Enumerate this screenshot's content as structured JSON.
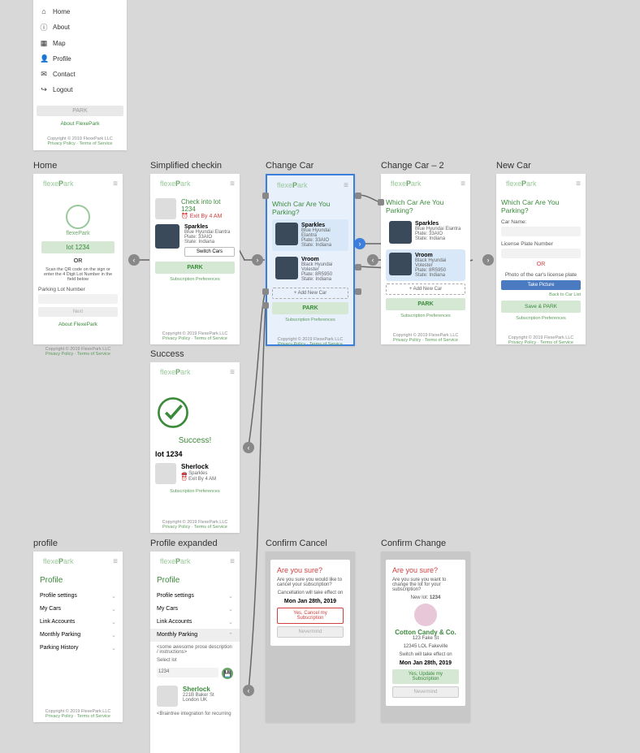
{
  "titles": {
    "home": "Home",
    "simplified": "Simplified checkin",
    "changeCar": "Change Car",
    "changeCar2": "Change Car – 2",
    "newCar": "New Car",
    "success": "Success",
    "profile": "profile",
    "profileExp": "Profile expanded",
    "confirmCancel": "Confirm Cancel",
    "confirmChange": "Confirm Change"
  },
  "sidebar": {
    "items": [
      {
        "icon": "⌂",
        "label": "Home"
      },
      {
        "icon": "ⓘ",
        "label": "About"
      },
      {
        "icon": "▦",
        "label": "Map"
      },
      {
        "icon": "👤",
        "label": "Profile"
      },
      {
        "icon": "✉",
        "label": "Contact"
      },
      {
        "icon": "↪",
        "label": "Logout"
      }
    ],
    "park_btn": "PARK",
    "about_link": "About FlexePark"
  },
  "brand": {
    "name": "flexePark"
  },
  "home": {
    "lot": "lot 1234",
    "or": "OR",
    "helper": "Scan the QR code on the sign or enter the 4 Digit Lot Number in the field below",
    "lot_label": "Parking Lot Number",
    "next": "Next",
    "about": "About FlexePark"
  },
  "footer": {
    "copyright": "Copyright © 2019 FlexePark LLC",
    "privacy": "Privacy Policy",
    "terms": "Terms of Service"
  },
  "checkin": {
    "title": "Check into lot 1234",
    "exit": "Exit By 4 AM",
    "car_name": "Sparkles",
    "car_desc": "Blue Hyundai Elantra",
    "plate": "Plate: 33AIO",
    "state": "State: Indiana",
    "switch": "Switch Cars",
    "park": "PARK",
    "prefs": "Subscription Preferences"
  },
  "change": {
    "title": "Which Car Are You Parking?",
    "car1_name": "Sparkles",
    "car1_desc": "Blue Hyundai Elantra",
    "car1_plate": "Plate: 33AIO",
    "car1_state": "State: Indiana",
    "car2_name": "Vroom",
    "car2_desc": "Black Hyundai Volester",
    "car2_plate": "Plate: 8R5950",
    "car2_state": "State: Indiana",
    "add": "+ Add New Car",
    "park": "PARK",
    "prefs": "Subscription Preferences"
  },
  "newcar": {
    "title": "Which Car Are You Parking?",
    "name_label": "Car Name:",
    "plate_label": "License Plate Number",
    "or": "OR",
    "photo_label": "Photo of the car's license plate",
    "take": "Take Picture",
    "back": "Back to Car List",
    "save": "Save & PARK",
    "prefs": "Subscription Preferences"
  },
  "success": {
    "title": "Success!",
    "lot": "lot 1234",
    "name": "Sherlock",
    "sub": "Sparkles",
    "exit": "Exit By 4 AM",
    "prefs": "Subscription Preferences"
  },
  "profile": {
    "title": "Profile",
    "items": [
      "Profile settings",
      "My Cars",
      "Link Accounts",
      "Monthly Parking",
      "Parking History"
    ]
  },
  "profileExp": {
    "desc": "<some awesome prose description / instructions>",
    "select": "Select lot",
    "lotval": "1234",
    "name": "Sherlock",
    "addr1": "221B Baker St",
    "addr2": "London UK",
    "braintree": "<Braintree integration for recurring"
  },
  "confirmCancel": {
    "title": "Are you sure?",
    "text": "Are you sure you would like to cancel your subscription?",
    "effect": "Cancellation will take effect on",
    "date": "Mon Jan 28th, 2019",
    "yes": "Yes, Cancel my Subscription",
    "no": "Nevermind"
  },
  "confirmChange": {
    "title": "Are you sure?",
    "text": "Are you sure you want to change the lot for your subscription?",
    "newlot_label": "New lot:",
    "newlot_val": "1234",
    "company": "Cotton Candy & Co.",
    "addr1": "123 Fake St",
    "addr2": "12345 LOL Fakeville",
    "effect": "Switch will take effect on",
    "date": "Mon Jan 28th, 2019",
    "yes": "Yes, Update my Subscription",
    "no": "Nevermind"
  }
}
